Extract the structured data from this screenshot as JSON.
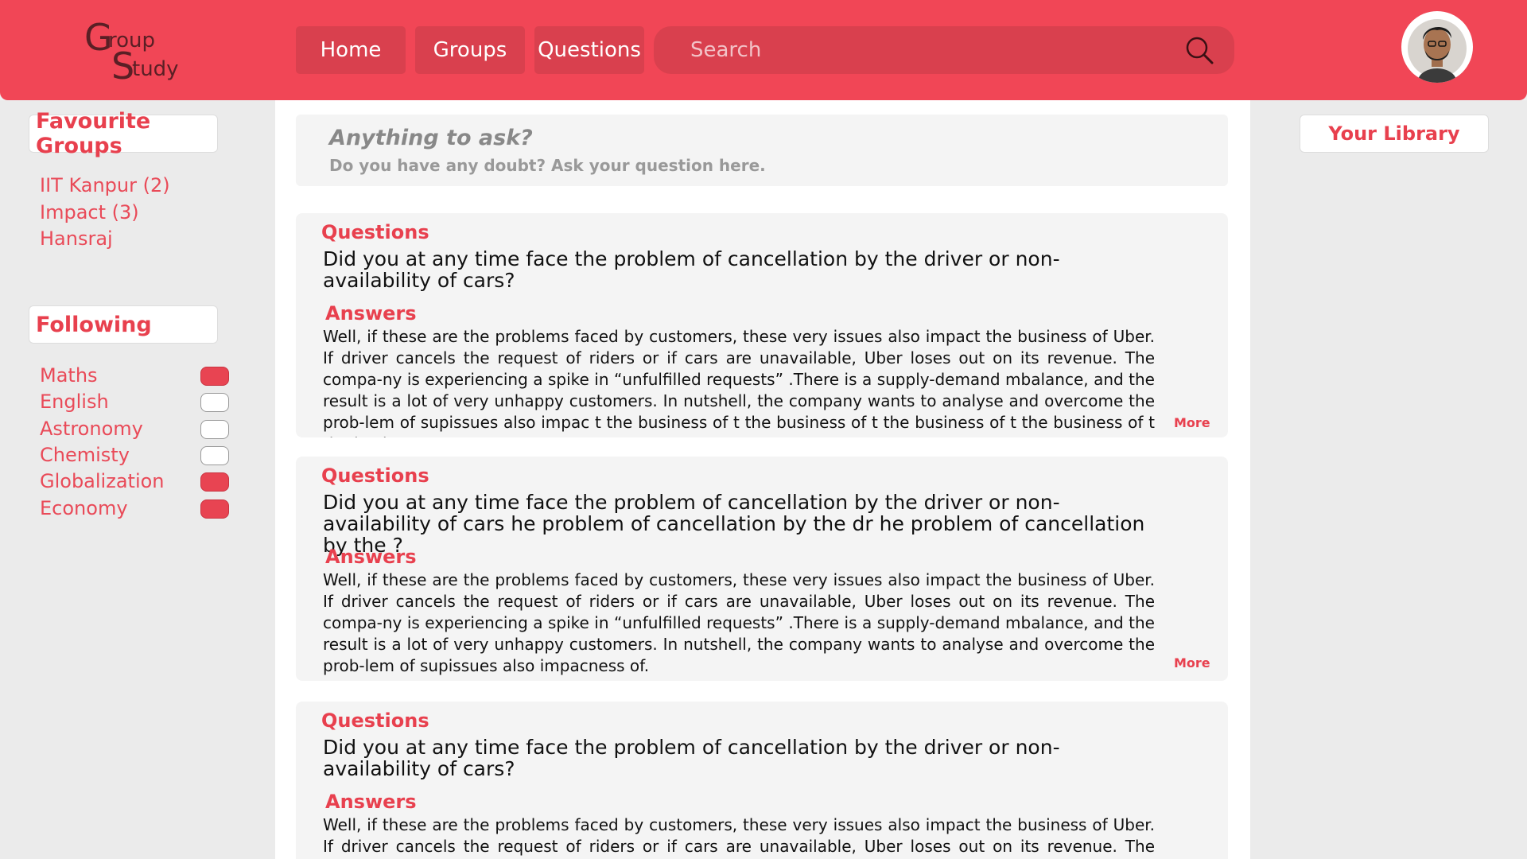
{
  "logo": {
    "g1": "G",
    "r1": "roup",
    "g2": "S",
    "r2": "tudy"
  },
  "nav": {
    "home": "Home",
    "groups": "Groups",
    "questions": "Questions"
  },
  "search": {
    "placeholder": "Search"
  },
  "sidebar": {
    "favourites_title": "Favourite Groups",
    "favourites": [
      "IIT Kanpur (2)",
      "Impact (3)",
      "Hansraj"
    ],
    "following_title": "Following",
    "following": [
      {
        "label": "Maths",
        "on": true
      },
      {
        "label": "English",
        "on": false
      },
      {
        "label": "Astronomy",
        "on": false
      },
      {
        "label": "Chemisty",
        "on": false
      },
      {
        "label": "Globalization",
        "on": true
      },
      {
        "label": "Economy",
        "on": true
      }
    ]
  },
  "ask": {
    "title": "Anything to ask?",
    "subtitle": "Do you have any doubt? Ask your question here."
  },
  "cards": [
    {
      "q_label": "Questions",
      "question": "Did you at any time face the problem of cancellation by the driver or non-availability of cars?",
      "a_label": "Answers",
      "answer": "Well, if these are the problems faced by customers, these very issues also impact the business of Uber. If driver cancels the request of riders or if cars are unavailable, Uber loses out on its revenue. The compa-ny is experiencing a spike in “unfulfilled requests” .There is a supply-demand mbalance, and the result is a lot of very unhappy customers. In nutshell, the company wants to analyse and overcome the prob-lem of supissues also impac t the business of t the business of t the business of t the business of t the busi-",
      "more": "More"
    },
    {
      "q_label": "Questions",
      "question": "Did you at any time face the problem of cancellation by the driver or non-availability of cars he problem of cancellation by the dr he problem of cancellation by the ?",
      "a_label": "Answers",
      "answer": "Well, if these are the problems faced by customers, these very issues also impact the business of Uber. If driver cancels the request of riders or if cars are unavailable, Uber loses out on its revenue. The compa-ny is experiencing a spike in “unfulfilled requests” .There is a supply-demand mbalance, and the result is a lot of very unhappy customers. In nutshell, the company wants to analyse and overcome the prob-lem of supissues also impacness of.",
      "more": "More"
    },
    {
      "q_label": "Questions",
      "question": "Did you at any time face the problem of cancellation by the driver or non-availability of cars?",
      "a_label": "Answers",
      "answer": "Well, if these are the problems faced by customers, these very issues also impact the business of Uber. If driver cancels the request of riders or if cars are unavailable, Uber loses out on its revenue. The compa-"
    }
  ],
  "library": {
    "label": "Your Library"
  },
  "colors": {
    "accent": "#f14656",
    "accent_dark": "#d9404e",
    "text_red": "#e8404e"
  },
  "icons": {
    "search": "search-icon",
    "avatar": "user-avatar"
  }
}
